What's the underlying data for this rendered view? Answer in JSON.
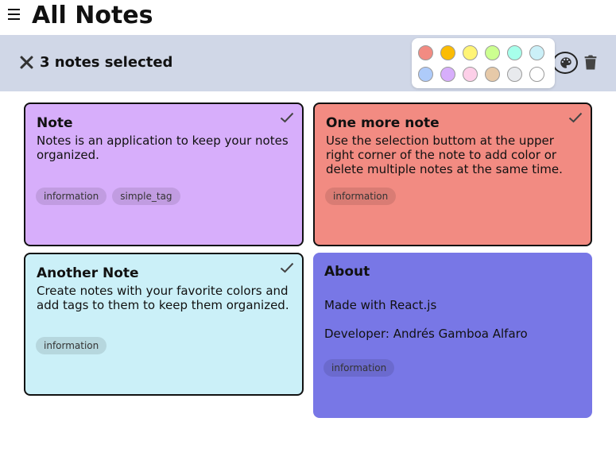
{
  "header": {
    "title": "All Notes",
    "menu_icon": "hamburger-icon"
  },
  "selection_bar": {
    "count_label": "3 notes selected",
    "close_icon": "close-icon",
    "palette_icon": "palette-icon",
    "delete_icon": "trash-icon"
  },
  "color_picker": {
    "colors": [
      "#f28b82",
      "#fbbc04",
      "#fff475",
      "#ccff90",
      "#a7ffeb",
      "#cbf0f8",
      "#aecbfa",
      "#d7aefb",
      "#fdcfe8",
      "#e6c9a8",
      "#e8eaed",
      "#ffffff"
    ]
  },
  "notes": [
    {
      "title": "Note",
      "body": "Notes is an application to keep your notes organized.",
      "tags": [
        "information",
        "simple_tag"
      ],
      "color": "#d7aefb",
      "selected": true
    },
    {
      "title": "One more note",
      "body": "Use the selection buttom at the upper right corner of the note to add color or delete multiple notes at the same time.",
      "tags": [
        "information"
      ],
      "color": "#f28b82",
      "selected": true
    },
    {
      "title": "Another Note",
      "body": "Create notes with your favorite colors and add tags to them to keep them organized.",
      "tags": [
        "information"
      ],
      "color": "#cbf0f8",
      "selected": true
    },
    {
      "title": "About",
      "lines": [
        "Made with React.js",
        "Developer: Andrés Gamboa Alfaro"
      ],
      "tags": [
        "information"
      ],
      "color": "#7877e6",
      "selected": false
    }
  ]
}
